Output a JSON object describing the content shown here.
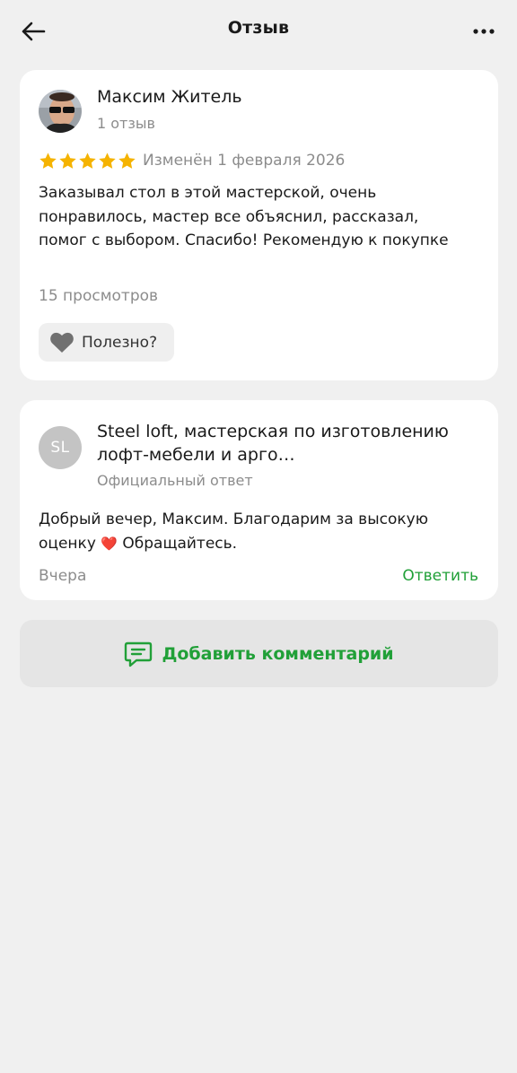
{
  "header": {
    "title": "Отзыв",
    "back_icon": "arrow-left-icon",
    "more_icon": "more-horizontal-icon"
  },
  "review": {
    "author_name": "Максим Житель",
    "author_reviews": "1 отзыв",
    "rating": 5,
    "rating_max": 5,
    "changed": "Изменён 1 февраля 2026",
    "text": "Заказывал стол в этой мастерской, очень понравилось, мастер все объяснил, рассказал, помог с выбором. Спасибо! Рекомендую к покупке",
    "views": "15 просмотров",
    "useful_label": "Полезно?"
  },
  "reply": {
    "avatar_initials": "SL",
    "org_name": "Steel loft, мастерская по изготовлению лофт-мебели и арго…",
    "subtitle": "Официальный ответ",
    "text_before": "Добрый вечер, Максим. Благодарим за высокую оценку",
    "emoji": "❤️",
    "text_after": " Обращайтесь.",
    "time": "Вчера",
    "action": "Ответить"
  },
  "add_comment": {
    "label": "Добавить комментарий",
    "icon": "comment-icon"
  },
  "colors": {
    "accent": "#21a038",
    "star": "#f5b301",
    "secondary_text": "#8c8c8c",
    "background": "#f0f0f0"
  }
}
